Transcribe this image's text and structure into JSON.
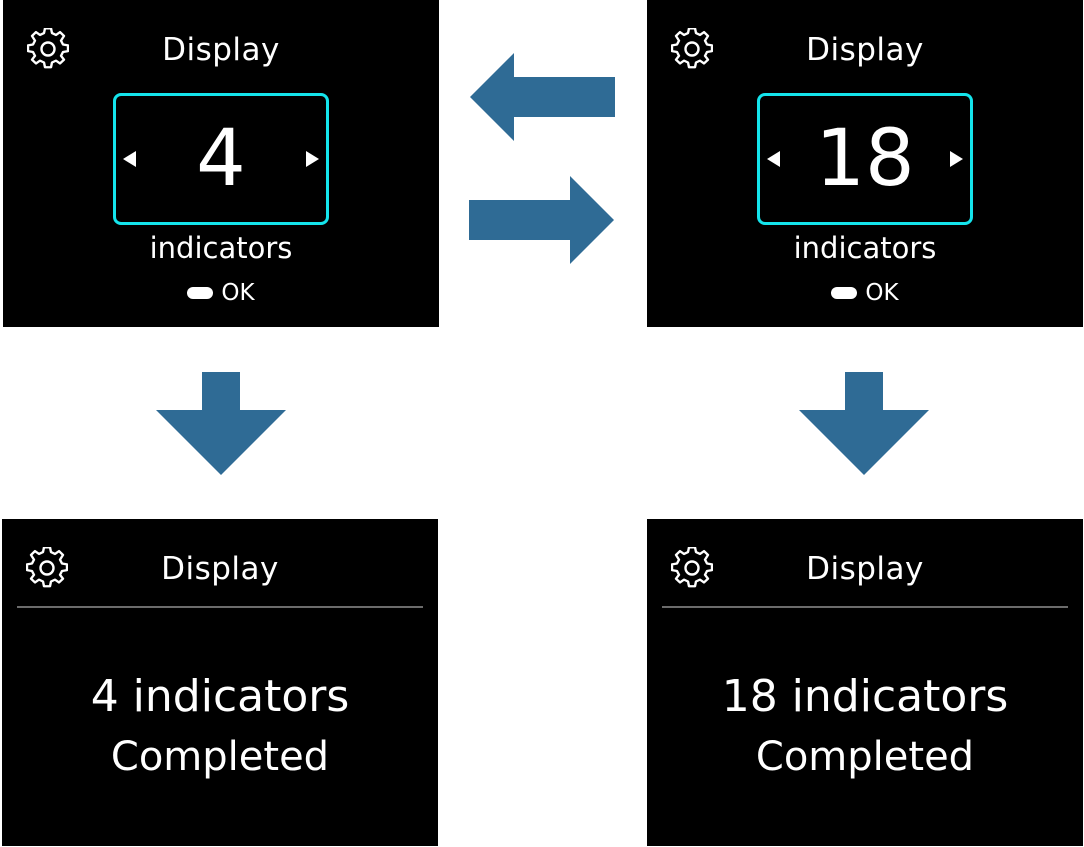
{
  "colors": {
    "screen_bg": "#000000",
    "text": "#ffffff",
    "accent_border": "#14e4ec",
    "arrow": "#2f6b95",
    "divider": "#6b6b6b"
  },
  "screens": {
    "top_left": {
      "icon": "gear-icon",
      "title": "Display",
      "value": "4",
      "unit": "indicators",
      "ok_label": "OK"
    },
    "top_right": {
      "icon": "gear-icon",
      "title": "Display",
      "value": "18",
      "unit": "indicators",
      "ok_label": "OK"
    },
    "bottom_left": {
      "icon": "gear-icon",
      "title": "Display",
      "line1": "4 indicators",
      "line2": "Completed"
    },
    "bottom_right": {
      "icon": "gear-icon",
      "title": "Display",
      "line1": "18 indicators",
      "line2": "Completed"
    }
  },
  "flow_arrows": [
    "arrow-left-icon",
    "arrow-right-icon",
    "arrow-down-icon",
    "arrow-down-icon"
  ]
}
